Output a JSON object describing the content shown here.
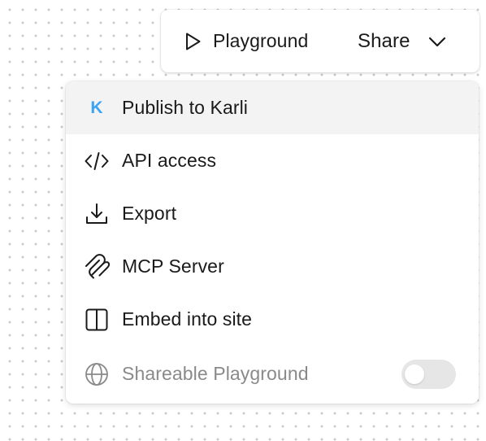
{
  "toolbar": {
    "playground_label": "Playground",
    "share_label": "Share"
  },
  "menu": {
    "items": [
      {
        "label": "Publish to Karli",
        "icon": "karli-logo-icon",
        "icon_text": "K",
        "highlighted": true
      },
      {
        "label": "API access",
        "icon": "code-icon"
      },
      {
        "label": "Export",
        "icon": "download-icon"
      },
      {
        "label": "MCP Server",
        "icon": "mcp-icon"
      },
      {
        "label": "Embed into site",
        "icon": "embed-panel-icon"
      },
      {
        "label": "Shareable Playground",
        "icon": "globe-icon",
        "toggle_on": false,
        "disabled": true
      }
    ]
  },
  "colors": {
    "accent": "#3aa4f2",
    "highlight_bg": "#f3f3f3",
    "muted_text": "#8a8a8a",
    "toggle_off": "#e6e6e6"
  }
}
